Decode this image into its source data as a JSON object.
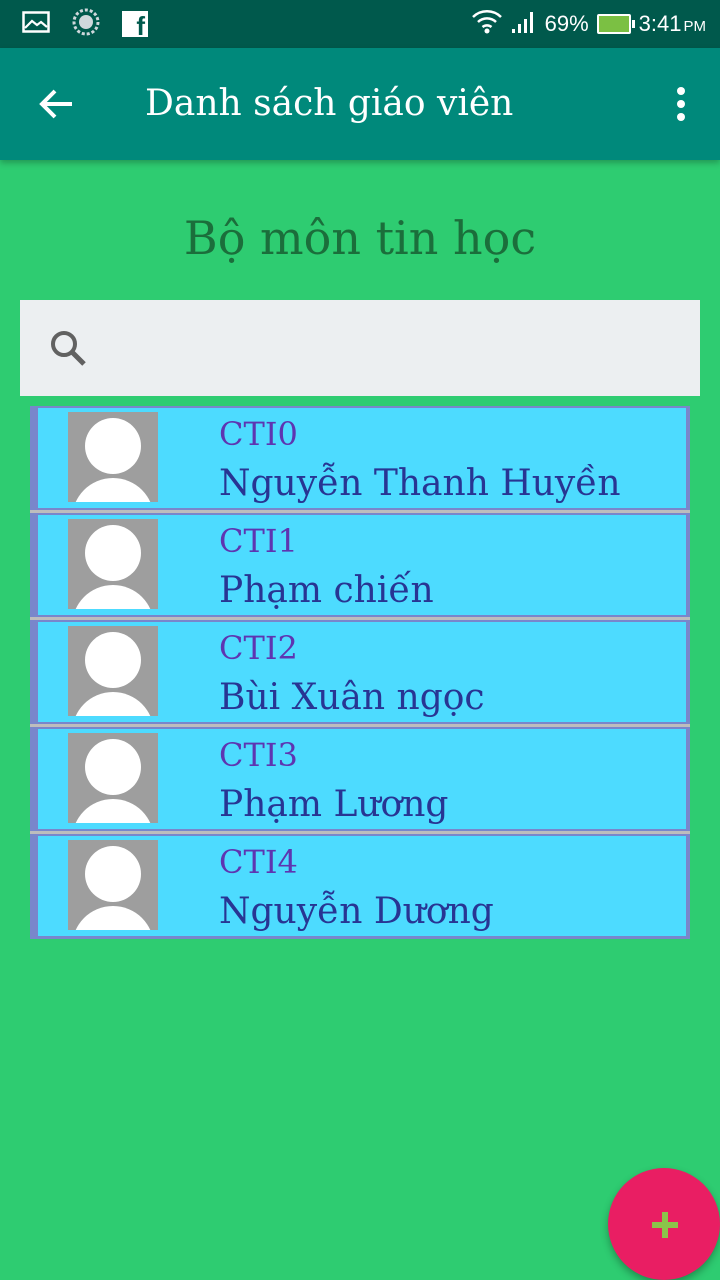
{
  "status_bar": {
    "icons_left": [
      "image-icon",
      "loading-icon",
      "facebook-icon"
    ],
    "facebook_glyph": "f",
    "battery": "69%",
    "time": "3:41",
    "ampm": "PM"
  },
  "app_bar": {
    "title": "Danh sách giáo viên"
  },
  "section": {
    "title": "Bộ môn tin học"
  },
  "search": {
    "placeholder": "",
    "value": ""
  },
  "teachers": [
    {
      "code": "CTI0",
      "name": "Nguyễn Thanh Huyền"
    },
    {
      "code": "CTI1",
      "name": "Phạm chiến"
    },
    {
      "code": "CTI2",
      "name": "Bùi Xuân ngọc"
    },
    {
      "code": "CTI3",
      "name": "Phạm Lương"
    },
    {
      "code": "CTI4",
      "name": "Nguyễn Dương"
    }
  ],
  "colors": {
    "background": "#2ecc71",
    "app_bar": "#00897b",
    "status_bar": "#00594c",
    "list_item": "#4ddbff",
    "fab": "#e91e63",
    "fab_icon": "#8bc34a"
  }
}
